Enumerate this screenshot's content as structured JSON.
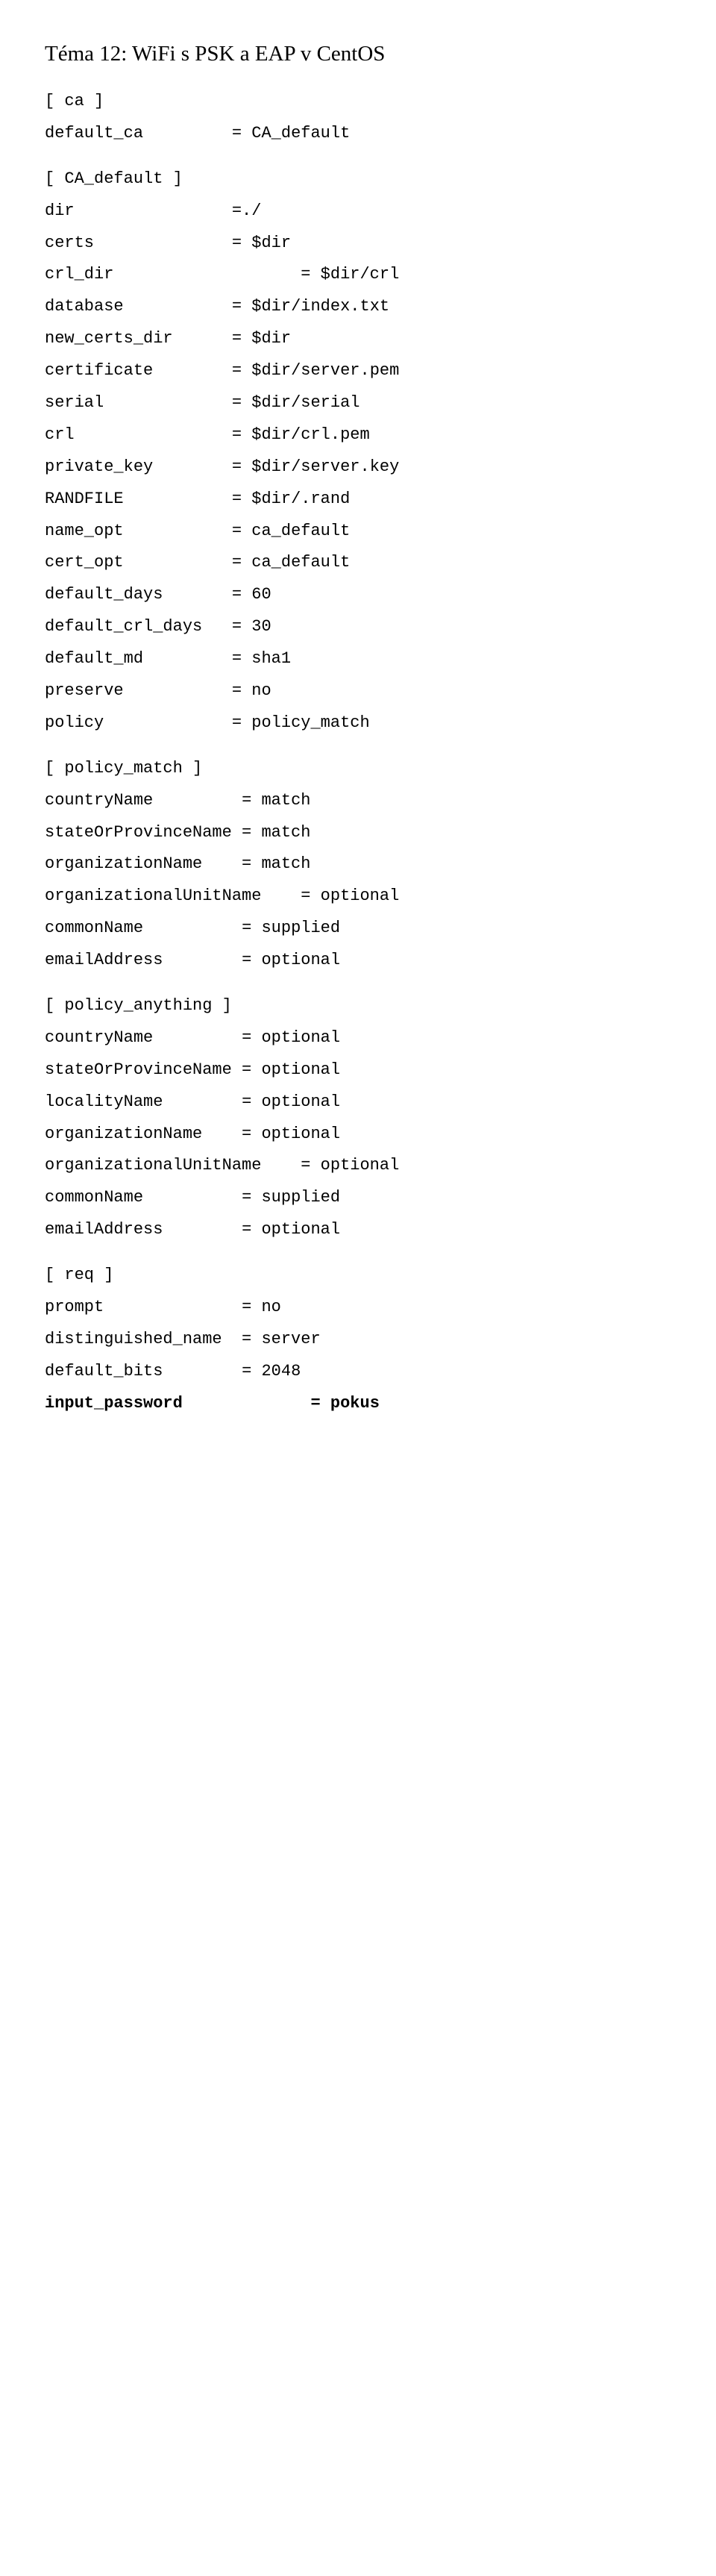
{
  "title": "Téma 12: WiFi s PSK a EAP v CentOS",
  "sections": [
    {
      "header": "[ ca ]",
      "rows": [
        {
          "key": "default_ca",
          "pad": 9,
          "val": "= CA_default",
          "bold": false
        }
      ]
    },
    {
      "header": "[ CA_default ]",
      "rows": [
        {
          "key": "dir",
          "pad": 16,
          "val": "=./",
          "bold": false
        },
        {
          "key": "certs",
          "pad": 14,
          "val": "= $dir",
          "bold": false
        },
        {
          "key": "crl_dir",
          "pad": 19,
          "val": "= $dir/crl",
          "bold": false
        },
        {
          "key": "database",
          "pad": 11,
          "val": "= $dir/index.txt",
          "bold": false
        },
        {
          "key": "new_certs_dir",
          "pad": 6,
          "val": "= $dir",
          "bold": false
        },
        {
          "key": "certificate",
          "pad": 8,
          "val": "= $dir/server.pem",
          "bold": false
        },
        {
          "key": "serial",
          "pad": 13,
          "val": "= $dir/serial",
          "bold": false
        },
        {
          "key": "crl",
          "pad": 16,
          "val": "= $dir/crl.pem",
          "bold": false
        },
        {
          "key": "private_key",
          "pad": 8,
          "val": "= $dir/server.key",
          "bold": false
        },
        {
          "key": "RANDFILE",
          "pad": 11,
          "val": "= $dir/.rand",
          "bold": false
        },
        {
          "key": "name_opt",
          "pad": 11,
          "val": "= ca_default",
          "bold": false
        },
        {
          "key": "cert_opt",
          "pad": 11,
          "val": "= ca_default",
          "bold": false
        },
        {
          "key": "default_days",
          "pad": 7,
          "val": "= 60",
          "bold": false
        },
        {
          "key": "default_crl_days",
          "pad": 3,
          "val": "= 30",
          "bold": false
        },
        {
          "key": "default_md",
          "pad": 9,
          "val": "= sha1",
          "bold": false
        },
        {
          "key": "preserve",
          "pad": 11,
          "val": "= no",
          "bold": false
        },
        {
          "key": "policy",
          "pad": 13,
          "val": "= policy_match",
          "bold": false
        }
      ]
    },
    {
      "header": "[ policy_match ]",
      "rows": [
        {
          "key": "countryName",
          "pad": 9,
          "val": "= match",
          "bold": false
        },
        {
          "key": "stateOrProvinceName",
          "pad": 1,
          "val": "= match",
          "bold": false
        },
        {
          "key": "organizationName",
          "pad": 4,
          "val": "= match",
          "bold": false
        },
        {
          "key": "organizationalUnitName",
          "pad": 4,
          "val": "= optional",
          "bold": false
        },
        {
          "key": "commonName",
          "pad": 10,
          "val": "= supplied",
          "bold": false
        },
        {
          "key": "emailAddress",
          "pad": 8,
          "val": "= optional",
          "bold": false
        }
      ]
    },
    {
      "header": "[ policy_anything ]",
      "rows": [
        {
          "key": "countryName",
          "pad": 9,
          "val": "= optional",
          "bold": false
        },
        {
          "key": "stateOrProvinceName",
          "pad": 1,
          "val": "= optional",
          "bold": false
        },
        {
          "key": "localityName",
          "pad": 8,
          "val": "= optional",
          "bold": false
        },
        {
          "key": "organizationName",
          "pad": 4,
          "val": "= optional",
          "bold": false
        },
        {
          "key": "organizationalUnitName",
          "pad": 4,
          "val": "= optional",
          "bold": false
        },
        {
          "key": "commonName",
          "pad": 10,
          "val": "= supplied",
          "bold": false
        },
        {
          "key": "emailAddress",
          "pad": 8,
          "val": "= optional",
          "bold": false
        }
      ]
    },
    {
      "header": "[ req ]",
      "rows": [
        {
          "key": "prompt",
          "pad": 14,
          "val": "= no",
          "bold": false
        },
        {
          "key": "distinguished_name",
          "pad": 2,
          "val": "= server",
          "bold": false
        },
        {
          "key": "default_bits",
          "pad": 8,
          "val": "= 2048",
          "bold": false
        },
        {
          "key": "input_password",
          "pad": 13,
          "val": "= pokus",
          "bold": true
        }
      ]
    }
  ]
}
